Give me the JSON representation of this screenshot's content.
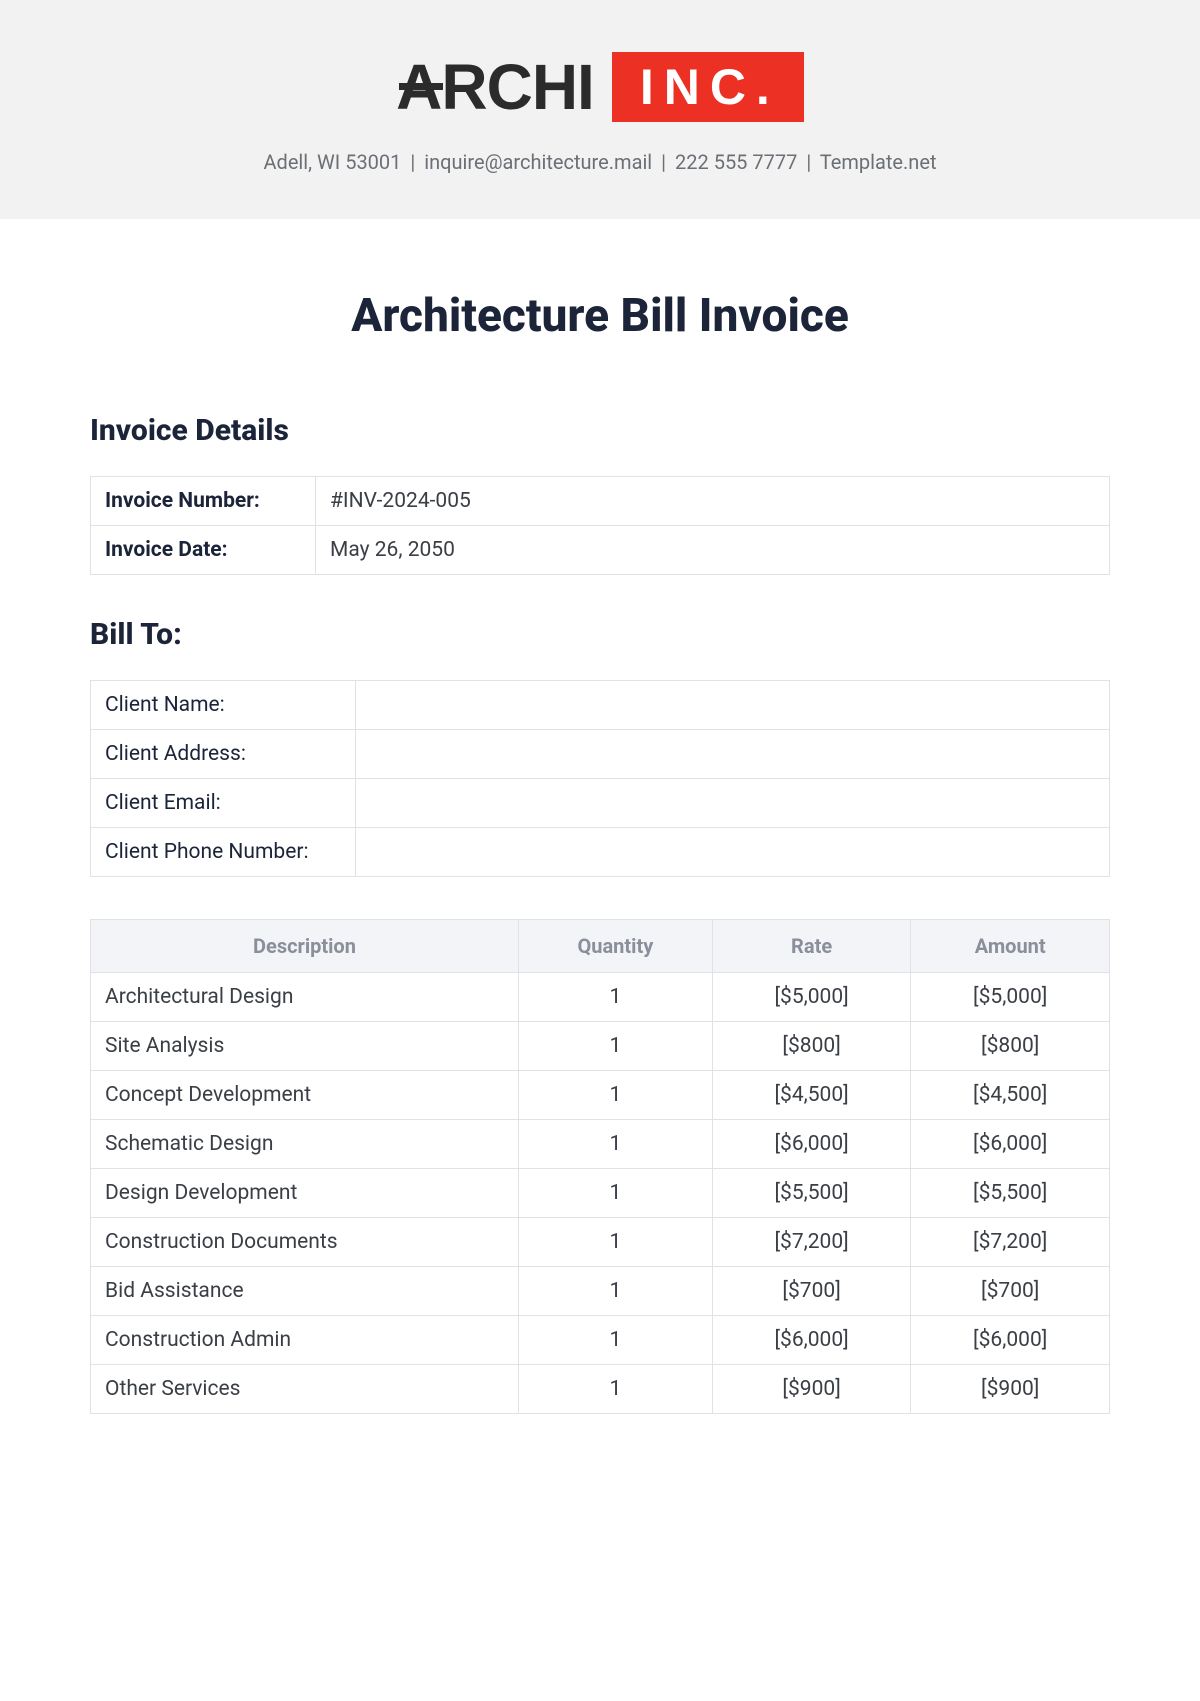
{
  "header": {
    "logo_left": "ARCHI",
    "logo_right": "INC.",
    "contact_address": "Adell, WI 53001",
    "contact_email": "inquire@architecture.mail",
    "contact_phone": "222 555 7777",
    "contact_site": "Template.net"
  },
  "document": {
    "title": "Architecture Bill Invoice"
  },
  "invoice_details": {
    "heading": "Invoice Details",
    "number_label": "Invoice Number:",
    "number_value": "#INV-2024-005",
    "date_label": "Invoice Date:",
    "date_value": "May 26, 2050"
  },
  "bill_to": {
    "heading": "Bill To:",
    "fields": [
      {
        "label": "Client Name:",
        "value": ""
      },
      {
        "label": "Client Address:",
        "value": ""
      },
      {
        "label": "Client Email:",
        "value": ""
      },
      {
        "label": "Client Phone Number:",
        "value": ""
      }
    ]
  },
  "items": {
    "columns": {
      "description": "Description",
      "quantity": "Quantity",
      "rate": "Rate",
      "amount": "Amount"
    },
    "rows": [
      {
        "description": "Architectural Design",
        "quantity": "1",
        "rate": "[$5,000]",
        "amount": "[$5,000]"
      },
      {
        "description": "Site Analysis",
        "quantity": "1",
        "rate": "[$800]",
        "amount": "[$800]"
      },
      {
        "description": "Concept Development",
        "quantity": "1",
        "rate": "[$4,500]",
        "amount": "[$4,500]"
      },
      {
        "description": "Schematic Design",
        "quantity": "1",
        "rate": "[$6,000]",
        "amount": "[$6,000]"
      },
      {
        "description": "Design Development",
        "quantity": "1",
        "rate": "[$5,500]",
        "amount": "[$5,500]"
      },
      {
        "description": "Construction Documents",
        "quantity": "1",
        "rate": "[$7,200]",
        "amount": "[$7,200]"
      },
      {
        "description": "Bid Assistance",
        "quantity": "1",
        "rate": "[$700]",
        "amount": "[$700]"
      },
      {
        "description": "Construction Admin",
        "quantity": "1",
        "rate": "[$6,000]",
        "amount": "[$6,000]"
      },
      {
        "description": "Other Services",
        "quantity": "1",
        "rate": "[$900]",
        "amount": "[$900]"
      }
    ]
  }
}
